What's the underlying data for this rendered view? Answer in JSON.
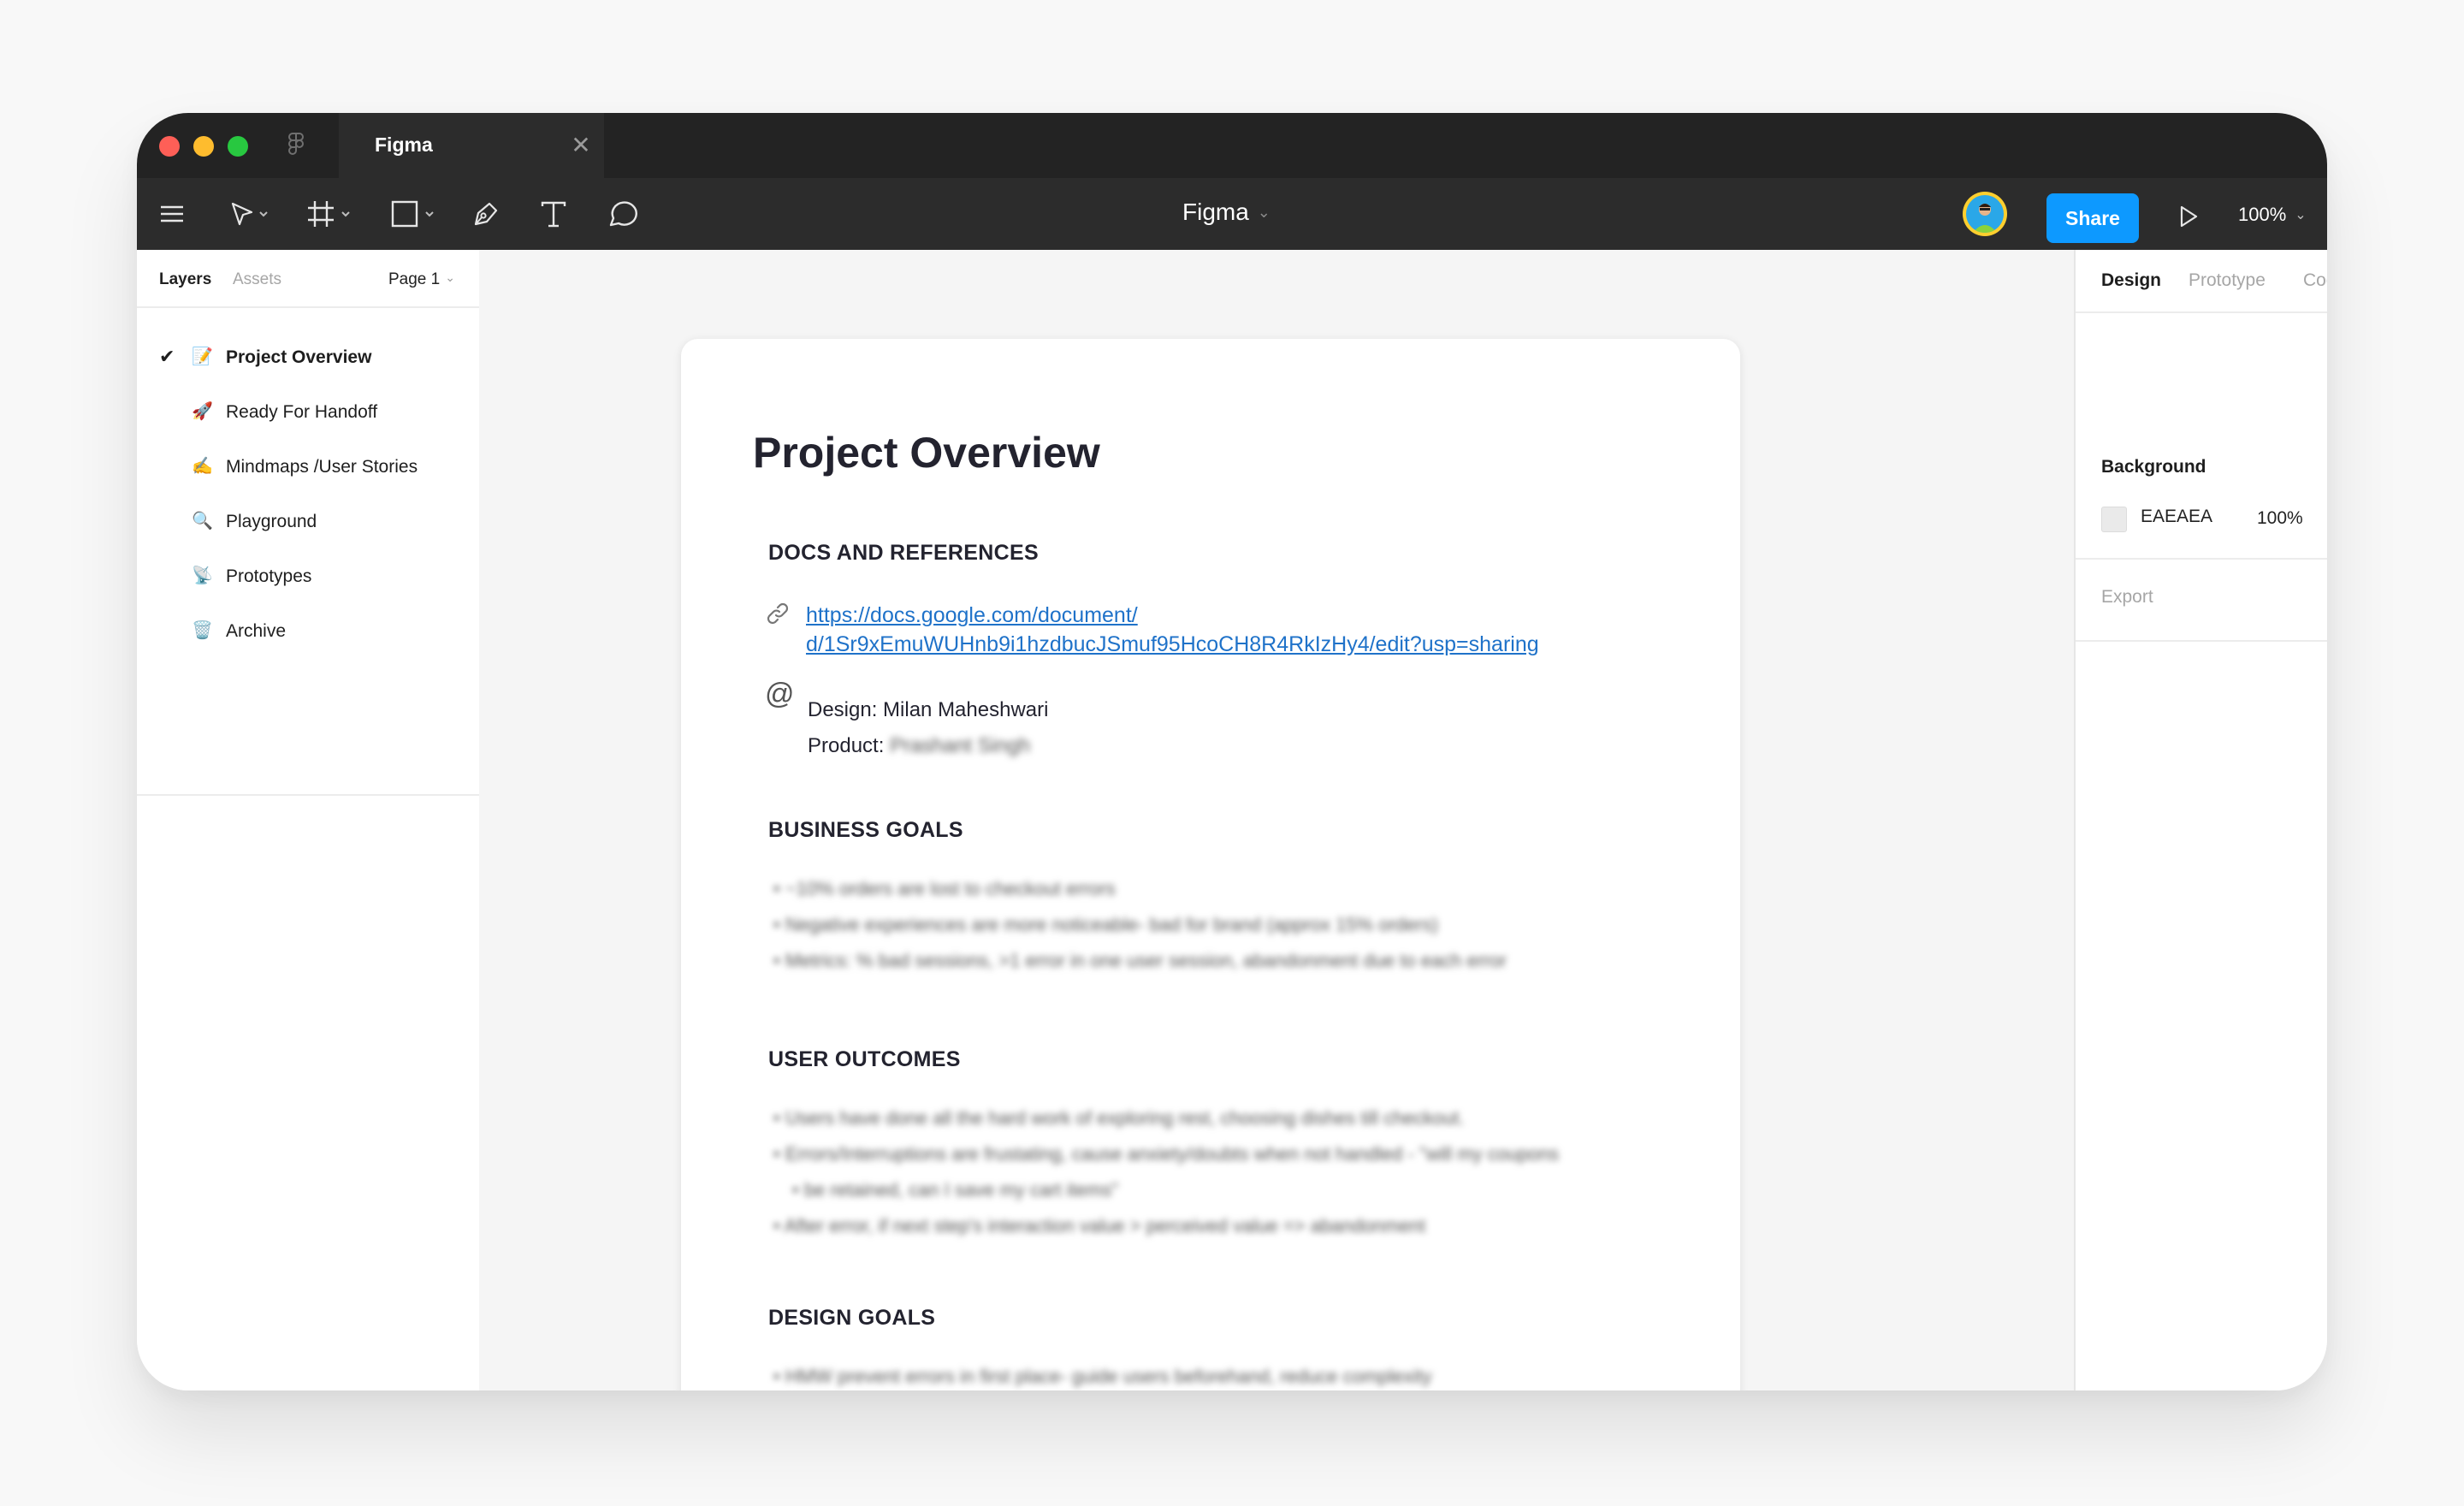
{
  "tab": {
    "title": "Figma",
    "close": "✕"
  },
  "toolbar": {
    "doc_title": "Figma",
    "share_label": "Share",
    "zoom": "100%"
  },
  "left_panel": {
    "tabs": {
      "layers": "Layers",
      "assets": "Assets"
    },
    "page_selector": "Page 1",
    "layers": [
      {
        "emoji": "📝",
        "name": "Project Overview",
        "active": true
      },
      {
        "emoji": "🚀",
        "name": "Ready For Handoff"
      },
      {
        "emoji": "✍️",
        "name": "Mindmaps /User Stories"
      },
      {
        "emoji": "🔍",
        "name": "Playground"
      },
      {
        "emoji": "📡",
        "name": "Prototypes"
      },
      {
        "emoji": "🗑️",
        "name": "Archive"
      }
    ]
  },
  "frame": {
    "title": "Project Overview",
    "docs_heading": "DOCS AND REFERENCES",
    "doc_link_line1": "https://docs.google.com/document/",
    "doc_link_line2": "d/1Sr9xEmuWUHnb9i1hzdbucJSmuf95HcoCH8R4RkIzHy4/edit?usp=sharing",
    "design_credit": "Design: Milan Maheshwari",
    "product_label": "Product:",
    "product_name": "Prashant Singh",
    "business_heading": "BUSINESS GOALS",
    "business_goals": [
      "~10% orders are lost to checkout errors",
      "Negative experiences are more noticeable- bad for brand (approx 15% orders)",
      "Metrics: % bad sessions, >1 error in one user session, abandonment due to each error"
    ],
    "user_heading": "USER OUTCOMES",
    "user_outcomes": [
      "Users have done all the hard work of exploring rest, choosing dishes till checkout.",
      "Errors/Interruptions are frustating, cause anxiety/doubts when not handled - \"will my coupons",
      "be retained, can I save my cart items\"",
      "After error, if next step's interaction value > perceived value => abandonment"
    ],
    "design_heading": "DESIGN GOALS",
    "design_goals": [
      "HMW prevent errors in first place- guide users beforehand, reduce complexity"
    ]
  },
  "right_panel": {
    "tabs": {
      "design": "Design",
      "prototype": "Prototype",
      "code": "Code"
    },
    "background_label": "Background",
    "background_hex": "EAEAEA",
    "background_opacity": "100%",
    "export_label": "Export",
    "export_add": "+"
  },
  "colors": {
    "accent": "#0d99ff",
    "link": "#1f72c9",
    "chrome": "#2c2c2c"
  }
}
